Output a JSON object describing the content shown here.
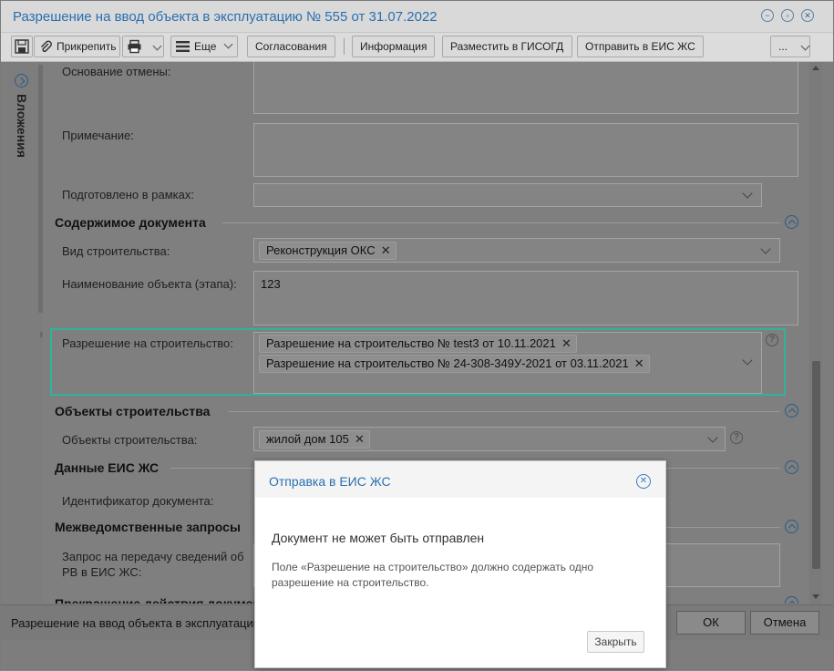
{
  "window": {
    "title": "Разрешение на ввод объекта в эксплуатацию № 555 от 31.07.2022"
  },
  "toolbar": {
    "attach": "Прикрепить",
    "more": "Еще",
    "approvals": "Согласования",
    "info": "Информация",
    "place_gisogd": "Разместить в ГИСОГД",
    "send_eis": "Отправить в ЕИС ЖС",
    "overflow": "..."
  },
  "sidebar": {
    "attachments": "Вложения"
  },
  "form": {
    "cancel_basis_label": "Основание отмены:",
    "note_label": "Примечание:",
    "prepared_within_label": "Подготовлено в рамках:",
    "section_contents": "Содержимое документа",
    "construction_kind_label": "Вид строительства:",
    "construction_kind_tag": "Реконструкция ОКС",
    "object_name_label": "Наименование объекта (этапа):",
    "object_name_value": "123",
    "permit_label": "Разрешение на строительство:",
    "permit_tags": [
      "Разрешение на строительство № test3 от 10.11.2021",
      "Разрешение на строительство № 24-308-349У-2021 от 03.11.2021"
    ],
    "section_objects": "Объекты строительства",
    "objects_label": "Объекты строительства:",
    "objects_tag": "жилой дом 105",
    "section_eis": "Данные ЕИС ЖС",
    "doc_id_label": "Идентификатор документа:",
    "section_requests": "Межведомственные запросы",
    "request_label_line1": "Запрос на передачу сведений об",
    "request_label_line2": "РВ в ЕИС ЖС:",
    "section_termination": "Прекращение действия документа"
  },
  "footer": {
    "status_text": "Разрешение на ввод объекта в эксплуатацию",
    "ok": "ОК",
    "cancel": "Отмена"
  },
  "dialog": {
    "title": "Отправка в ЕИС ЖС",
    "message": "Документ не может быть отправлен",
    "details": "Поле «Разрешение на строительство» должно содержать одно разрешение на строительство.",
    "close_button": "Закрыть"
  },
  "colors": {
    "accent": "#2a6fb0",
    "highlight_border": "#2fb39a"
  }
}
